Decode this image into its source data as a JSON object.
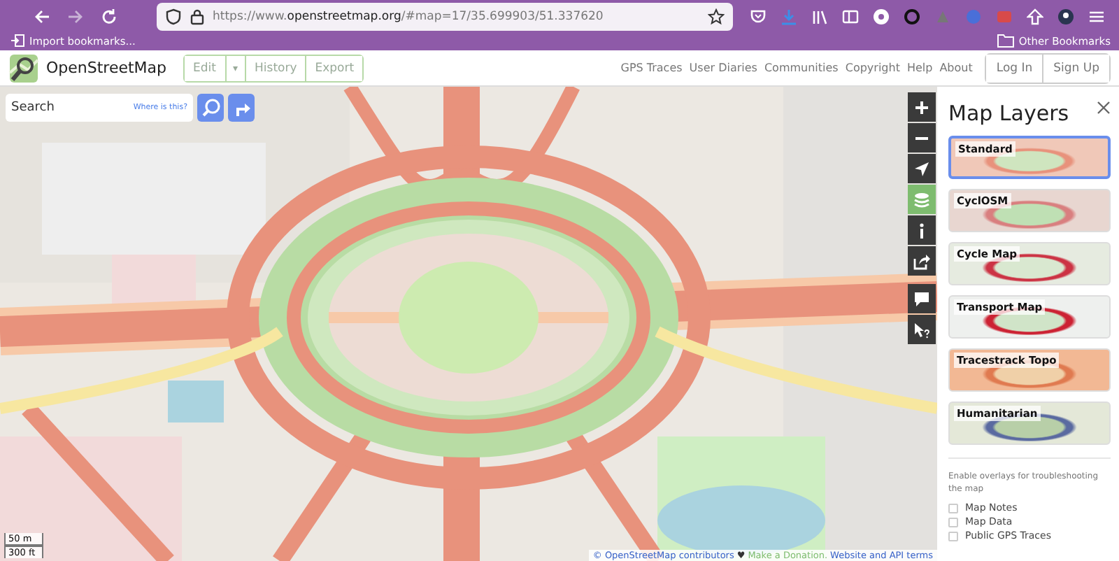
{
  "browser": {
    "url": "https://www.**openstreetmap.org**/#map=17/35.699903/51.337620",
    "bookmarks": [
      {
        "label": "Import bookmarks..."
      }
    ],
    "other_bookmarks": "Other Bookmarks"
  },
  "header": {
    "brand": "OpenStreetMap",
    "edit_buttons": [
      {
        "kind": "text",
        "label": "Edit"
      },
      {
        "kind": "caret",
        "label": "▾"
      },
      {
        "kind": "text",
        "label": "History"
      },
      {
        "kind": "text",
        "label": "Export"
      }
    ],
    "nav": [
      "GPS Traces",
      "User Diaries",
      "Communities",
      "Copyright",
      "Help",
      "About"
    ],
    "account": [
      "Log In",
      "Sign Up"
    ]
  },
  "search": {
    "placeholder": "Search",
    "where_link": "Where is this?"
  },
  "map_controls": [
    {
      "kind": "zoom-in",
      "selected": false
    },
    {
      "kind": "zoom-out",
      "selected": false
    },
    {
      "kind": "locate",
      "selected": false
    },
    {
      "kind": "layers",
      "selected": true
    },
    {
      "kind": "info",
      "selected": false
    },
    {
      "kind": "share",
      "selected": false
    },
    {
      "kind": "note",
      "selected": false
    },
    {
      "kind": "query",
      "selected": false
    }
  ],
  "scale": [
    "50 m",
    "300 ft"
  ],
  "attribution": {
    "contributors": "© OpenStreetMap contributors",
    "heart": "♥",
    "donate": "Make a Donation.",
    "terms": "Website and API terms"
  },
  "layers_panel": {
    "title": "Map Layers",
    "layers": [
      {
        "label": "Standard",
        "selected": true
      },
      {
        "label": "CyclOSM",
        "selected": false
      },
      {
        "label": "Cycle Map",
        "selected": false
      },
      {
        "label": "Transport Map",
        "selected": false
      },
      {
        "label": "Tracestrack Topo",
        "selected": false
      },
      {
        "label": "Humanitarian",
        "selected": false
      }
    ],
    "overlay_hint": "Enable overlays for troubleshooting the map",
    "overlays": [
      {
        "label": "Map Notes",
        "checked": false
      },
      {
        "label": "Map Data",
        "checked": false
      },
      {
        "label": "Public GPS Traces",
        "checked": false
      }
    ]
  }
}
